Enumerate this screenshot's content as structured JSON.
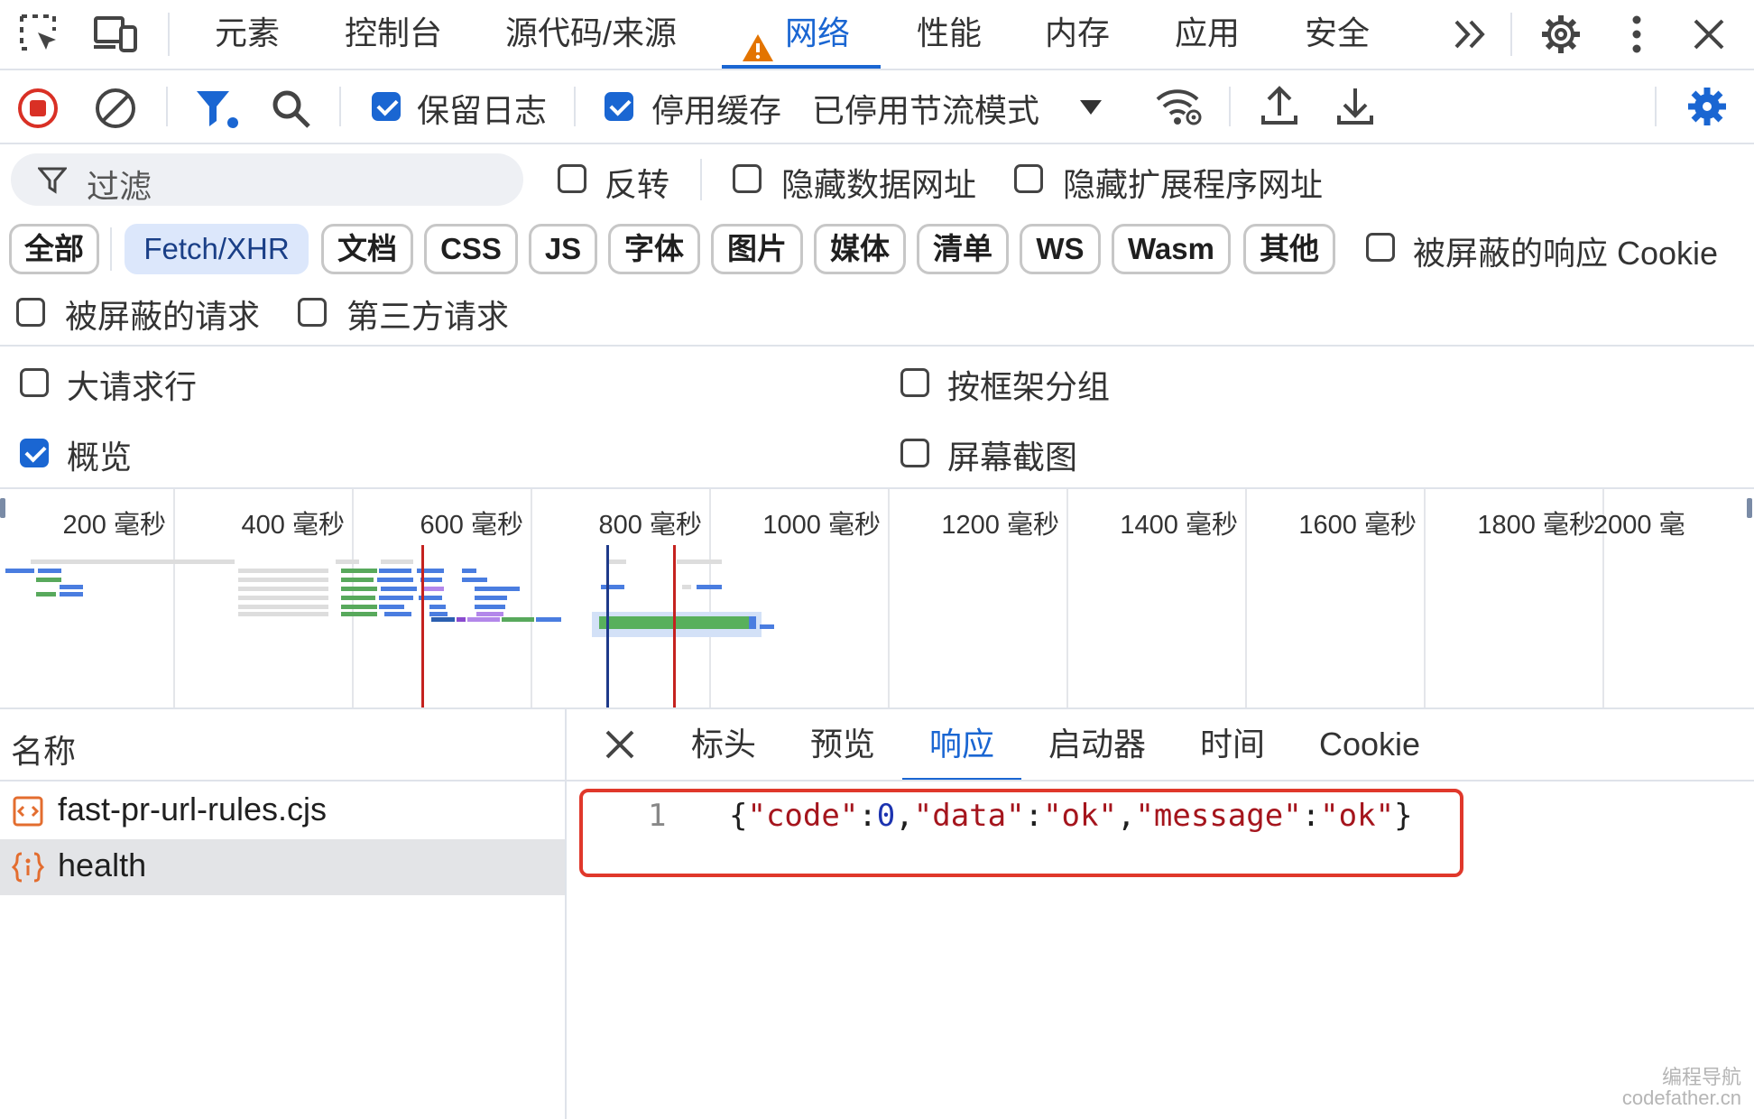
{
  "top_tabs": [
    "元素",
    "控制台",
    "源代码/来源",
    "网络",
    "性能",
    "内存",
    "应用",
    "安全"
  ],
  "toolbar": {
    "preserve_log": "保留日志",
    "disable_cache": "停用缓存",
    "throttling": "已停用节流模式"
  },
  "filter": {
    "placeholder": "过滤",
    "invert": "反转",
    "hide_data_urls": "隐藏数据网址",
    "hide_extension_urls": "隐藏扩展程序网址"
  },
  "type_chips": [
    "全部",
    "Fetch/XHR",
    "文档",
    "CSS",
    "JS",
    "字体",
    "图片",
    "媒体",
    "清单",
    "WS",
    "Wasm",
    "其他"
  ],
  "blocked_cookies": "被屏蔽的响应 Cookie",
  "blocked_requests": "被屏蔽的请求",
  "third_party": "第三方请求",
  "settings": {
    "big_rows": "大请求行",
    "group_by_frame": "按框架分组",
    "overview": "概览",
    "screenshots": "屏幕截图"
  },
  "timeline_ticks": [
    "200 毫秒",
    "400 毫秒",
    "600 毫秒",
    "800 毫秒",
    "1000 毫秒",
    "1200 毫秒",
    "1400 毫秒",
    "1600 毫秒",
    "1800 毫秒",
    "2000 毫"
  ],
  "request_list": {
    "header": "名称",
    "items": [
      {
        "name": "fast-pr-url-rules.cjs"
      },
      {
        "name": "health"
      }
    ]
  },
  "detail_tabs": [
    "标头",
    "预览",
    "响应",
    "启动器",
    "时间",
    "Cookie"
  ],
  "response": {
    "line_number": "1",
    "code_tokens": [
      {
        "t": "{",
        "k": "p"
      },
      {
        "t": "\"code\"",
        "k": "s"
      },
      {
        "t": ":",
        "k": "p"
      },
      {
        "t": "0",
        "k": "n"
      },
      {
        "t": ",",
        "k": "p"
      },
      {
        "t": "\"data\"",
        "k": "s"
      },
      {
        "t": ":",
        "k": "p"
      },
      {
        "t": "\"ok\"",
        "k": "s"
      },
      {
        "t": ",",
        "k": "p"
      },
      {
        "t": "\"message\"",
        "k": "s"
      },
      {
        "t": ":",
        "k": "p"
      },
      {
        "t": "\"ok\"",
        "k": "s"
      },
      {
        "t": "}",
        "k": "p"
      }
    ]
  },
  "watermark": {
    "line1": "编程导航",
    "line2": "codefather.cn"
  },
  "colors": {
    "accent": "#1a66d2",
    "record_red": "#d93025",
    "warning_orange": "#e37400",
    "highlight_box": "#e0382b"
  }
}
